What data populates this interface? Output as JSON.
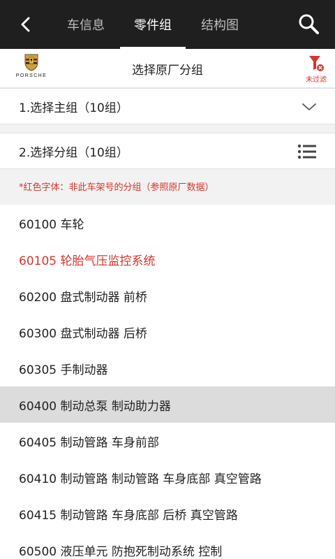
{
  "colors": {
    "topbar_bg": "#1f1f1f",
    "accent_red": "#d9342b",
    "selected_bg": "#dcdcdc"
  },
  "topbar": {
    "back_icon": "chevron-left-icon",
    "tabs": [
      {
        "label": "车信息",
        "active": false
      },
      {
        "label": "零件组",
        "active": true
      },
      {
        "label": "结构图",
        "active": false
      }
    ],
    "search_icon": "search-icon"
  },
  "header": {
    "logo_text": "PORSCHE",
    "title": "选择原厂分组",
    "filter_label": "未过滤",
    "filter_icon": "funnel-icon"
  },
  "main_group": {
    "label": "1.选择主组（10组）",
    "icon": "chevron-down-icon"
  },
  "sub_group": {
    "label": "2.选择分组（10组）",
    "icon": "list-icon"
  },
  "note": "*红色字体：非此车架号的分组（参照原厂数据）",
  "items": [
    {
      "label": "60100 车轮",
      "red": false,
      "selected": false
    },
    {
      "label": "60105 轮胎气压监控系统",
      "red": true,
      "selected": false
    },
    {
      "label": "60200 盘式制动器 前桥",
      "red": false,
      "selected": false
    },
    {
      "label": "60300 盘式制动器 后桥",
      "red": false,
      "selected": false
    },
    {
      "label": "60305 手制动器",
      "red": false,
      "selected": false
    },
    {
      "label": "60400 制动总泵 制动助力器",
      "red": false,
      "selected": true
    },
    {
      "label": "60405 制动管路 车身前部",
      "red": false,
      "selected": false
    },
    {
      "label": "60410 制动管路 制动管路 车身底部 真空管路",
      "red": false,
      "selected": false
    },
    {
      "label": "60415 制动管路 车身底部 后桥 真空管路",
      "red": false,
      "selected": false
    },
    {
      "label": "60500 液压单元 防抱死制动系统 控制",
      "red": false,
      "selected": false
    }
  ]
}
